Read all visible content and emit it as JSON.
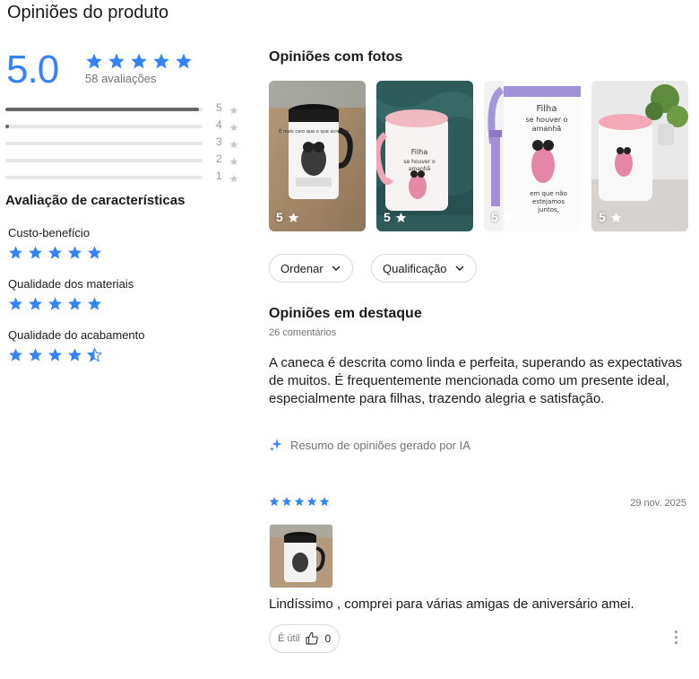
{
  "page_title": "Opiniões do produto",
  "rating": {
    "average": "5.0",
    "count_text": "58 avaliações",
    "stars_filled": 5,
    "distribution": [
      {
        "stars": "5",
        "fraction": 0.98
      },
      {
        "stars": "4",
        "fraction": 0.02
      },
      {
        "stars": "3",
        "fraction": 0
      },
      {
        "stars": "2",
        "fraction": 0
      },
      {
        "stars": "1",
        "fraction": 0
      }
    ]
  },
  "characteristics": {
    "title": "Avaliação de características",
    "items": [
      {
        "label": "Custo-benefício",
        "rating": 5
      },
      {
        "label": "Qualidade dos materiais",
        "rating": 5
      },
      {
        "label": "Qualidade do acabamento",
        "rating": 4.5
      }
    ]
  },
  "photos_section": {
    "title": "Opiniões com fotos",
    "photos": [
      {
        "rating": "5",
        "icon": "star-icon",
        "text_on_mug": "É mais caro que o que acredita"
      },
      {
        "rating": "5",
        "icon": "star-icon",
        "text_on_mug": "Filha se houver o amanhã em que não estejamos juntos"
      },
      {
        "rating": "5",
        "icon": "star-icon",
        "text_on_mug": "Filha se houver o amanhã em que não estejamos juntos,"
      },
      {
        "rating": "5",
        "icon": "star-icon",
        "text_on_mug": ""
      }
    ]
  },
  "filters": {
    "sort_label": "Ordenar",
    "rating_label": "Qualificação"
  },
  "highlights": {
    "title": "Opiniões em destaque",
    "comments_count": "26 comentários",
    "summary": "A caneca é descrita como linda e perfeita, superando as expectativas de muitos. É frequentemente mencionada como um presente ideal, especialmente para filhas, trazendo alegria e satisfação.",
    "ai_note": "Resumo de opiniões gerado por IA"
  },
  "review": {
    "stars": 5,
    "date": "29 nov. 2025",
    "text": "Lindíssimo , comprei para várias amigas de aniversário amei.",
    "useful_label": "É útil",
    "useful_count": "0"
  },
  "colors": {
    "accent": "#3483fa",
    "text": "#1a1a1a",
    "muted": "#737373",
    "bar_fill": "#666666",
    "bar_track": "#e6e6e6"
  }
}
